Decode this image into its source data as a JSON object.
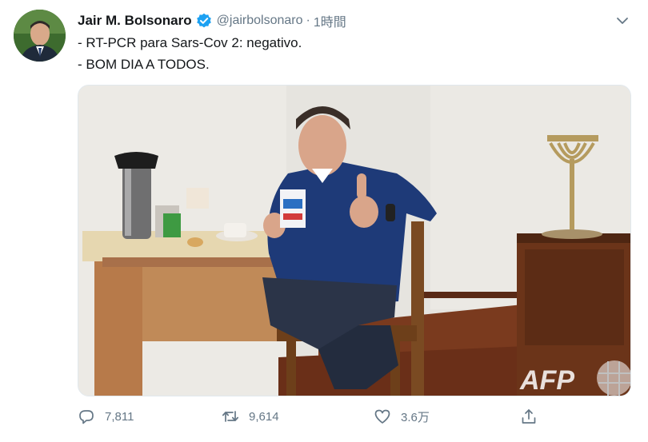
{
  "tweet": {
    "display_name": "Jair M. Bolsonaro",
    "handle": "@jairbolsonaro",
    "separator": "·",
    "time": "1時間",
    "lines": [
      "- RT-PCR para Sars-Cov 2: negativo.",
      "- BOM DIA A TODOS."
    ]
  },
  "media": {
    "watermark": "AFP"
  },
  "actions": {
    "reply_count": "7,811",
    "retweet_count": "9,614",
    "like_count": "3.6万"
  },
  "colors": {
    "text": "#14171a",
    "secondary": "#657786",
    "verified": "#1da1f2"
  },
  "icons": {
    "verified": "verified-badge-icon",
    "caret": "chevron-down-icon",
    "reply": "reply-icon",
    "retweet": "retweet-icon",
    "like": "heart-icon",
    "share": "share-icon"
  }
}
